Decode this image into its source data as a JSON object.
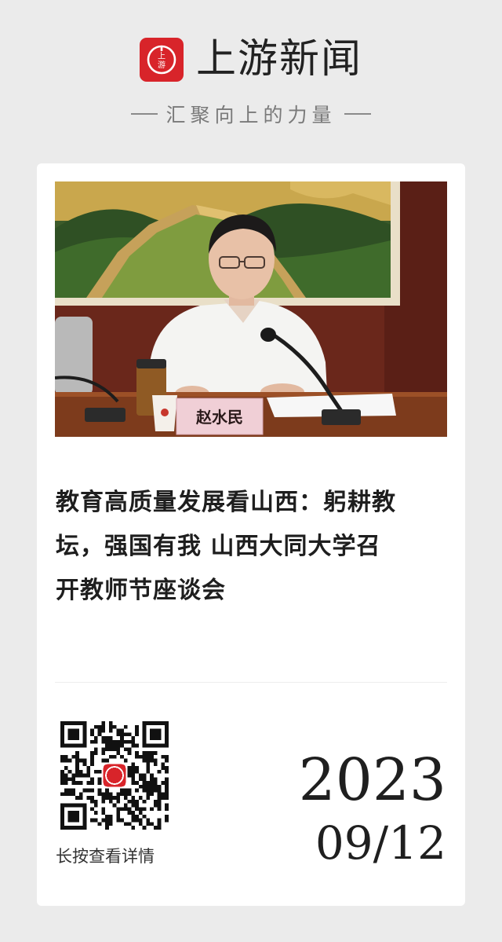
{
  "header": {
    "logo_text": "上游",
    "brand_name": "上游新闻",
    "slogan": "汇聚向上的力量"
  },
  "card": {
    "photo": {
      "nameplate": "赵水民"
    },
    "headline_lines": [
      "教育高质量发展看山西：躬耕教",
      "坛，强国有我 山西大同大学召",
      "开教师节座谈会"
    ],
    "qr": {
      "center_logo_text": "上游",
      "label": "长按查看详情"
    },
    "date": {
      "year": "2023",
      "month_day": "09/12"
    }
  },
  "colors": {
    "brand_red": "#d8242a",
    "page_background": "#ebebeb",
    "card_background": "#ffffff"
  },
  "icons": [
    "shangyou-logo-icon",
    "qr-code-icon"
  ]
}
